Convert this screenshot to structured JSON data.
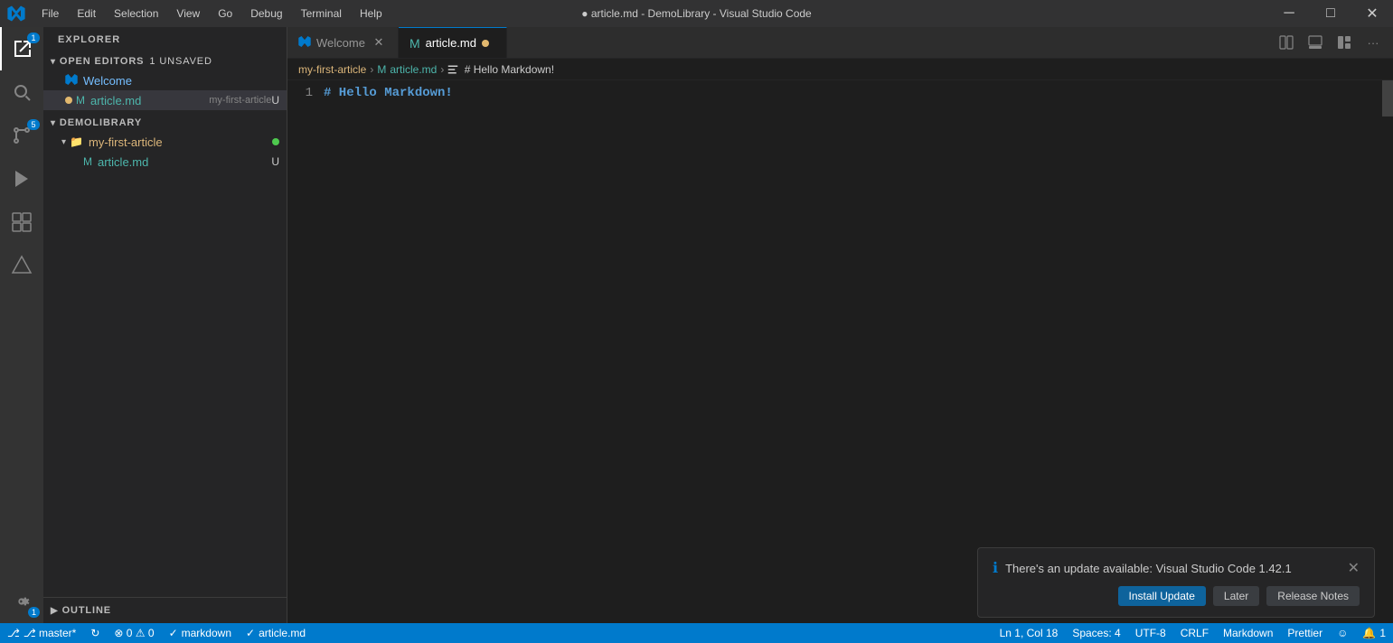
{
  "window": {
    "title": "● article.md - DemoLibrary - Visual Studio Code",
    "controls": {
      "minimize": "─",
      "maximize": "□",
      "close": "✕"
    }
  },
  "menu": {
    "items": [
      "File",
      "Edit",
      "Selection",
      "View",
      "Go",
      "Debug",
      "Terminal",
      "Help"
    ]
  },
  "activity_bar": {
    "icons": [
      {
        "name": "explorer-icon",
        "symbol": "⎘",
        "label": "Explorer",
        "active": true,
        "badge": "1"
      },
      {
        "name": "search-icon",
        "symbol": "🔍",
        "label": "Search",
        "active": false
      },
      {
        "name": "source-control-icon",
        "symbol": "⑂",
        "label": "Source Control",
        "active": false,
        "badge": "5"
      },
      {
        "name": "debug-icon",
        "symbol": "▷",
        "label": "Run",
        "active": false
      },
      {
        "name": "extensions-icon",
        "symbol": "⊞",
        "label": "Extensions",
        "active": false
      },
      {
        "name": "accounts-icon",
        "symbol": "△",
        "label": "Accounts",
        "active": false
      }
    ],
    "bottom": [
      {
        "name": "settings-icon",
        "symbol": "⚙",
        "label": "Settings",
        "badge": "1"
      }
    ]
  },
  "sidebar": {
    "title": "EXPLORER",
    "sections": [
      {
        "id": "open-editors",
        "label": "OPEN EDITORS",
        "badge": "1 UNSAVED",
        "items": [
          {
            "name": "Welcome",
            "icon": "vscode",
            "color": "welcome",
            "path": ""
          },
          {
            "name": "article.md",
            "icon": "markdown",
            "color": "article",
            "modifier": "my-first-article",
            "badge": "U",
            "dot": true
          }
        ]
      },
      {
        "id": "demolibrary",
        "label": "DEMOLIBRARY",
        "items": [
          {
            "name": "my-first-article",
            "icon": "folder",
            "color": "folder",
            "expanded": true,
            "greenDot": true,
            "children": [
              {
                "name": "article.md",
                "icon": "markdown",
                "color": "article",
                "badge": "U"
              }
            ]
          }
        ]
      }
    ]
  },
  "tabs": [
    {
      "id": "welcome",
      "label": "Welcome",
      "icon": "vscode",
      "active": false,
      "unsaved": false
    },
    {
      "id": "article",
      "label": "article.md",
      "icon": "markdown",
      "active": true,
      "unsaved": true
    }
  ],
  "tab_actions": [
    "split-editor-icon",
    "toggle-panel-icon",
    "customize-layout-icon",
    "more-actions-icon"
  ],
  "breadcrumb": {
    "items": [
      {
        "label": "my-first-article",
        "type": "folder"
      },
      {
        "label": "article.md",
        "type": "file"
      },
      {
        "label": "# Hello Markdown!",
        "type": "heading"
      }
    ]
  },
  "editor": {
    "lines": [
      {
        "number": "1",
        "content": "# Hello Markdown!",
        "color": "#569cd6"
      }
    ]
  },
  "outline": {
    "label": "OUTLINE"
  },
  "notification": {
    "text": "There's an update available: Visual Studio Code 1.42.1",
    "buttons": {
      "install": "Install Update",
      "later": "Later",
      "release_notes": "Release Notes"
    }
  },
  "status_bar": {
    "left": [
      {
        "id": "branch",
        "text": "⎇ master*",
        "icon": "git-branch-icon"
      },
      {
        "id": "sync",
        "text": "↻",
        "icon": "sync-icon"
      },
      {
        "id": "errors",
        "text": "⊗ 0  ⚠ 0",
        "icon": "error-warning-icon"
      }
    ],
    "right": [
      {
        "id": "ln-col",
        "text": "Ln 1, Col 18"
      },
      {
        "id": "spaces",
        "text": "Spaces: 4"
      },
      {
        "id": "encoding",
        "text": "UTF-8"
      },
      {
        "id": "eol",
        "text": "CRLF"
      },
      {
        "id": "language",
        "text": "Markdown"
      },
      {
        "id": "formatter",
        "text": "Prettier"
      },
      {
        "id": "feedback",
        "text": "☺",
        "icon": "feedback-icon"
      },
      {
        "id": "notifications",
        "text": "🔔 1",
        "icon": "notification-icon"
      }
    ]
  }
}
